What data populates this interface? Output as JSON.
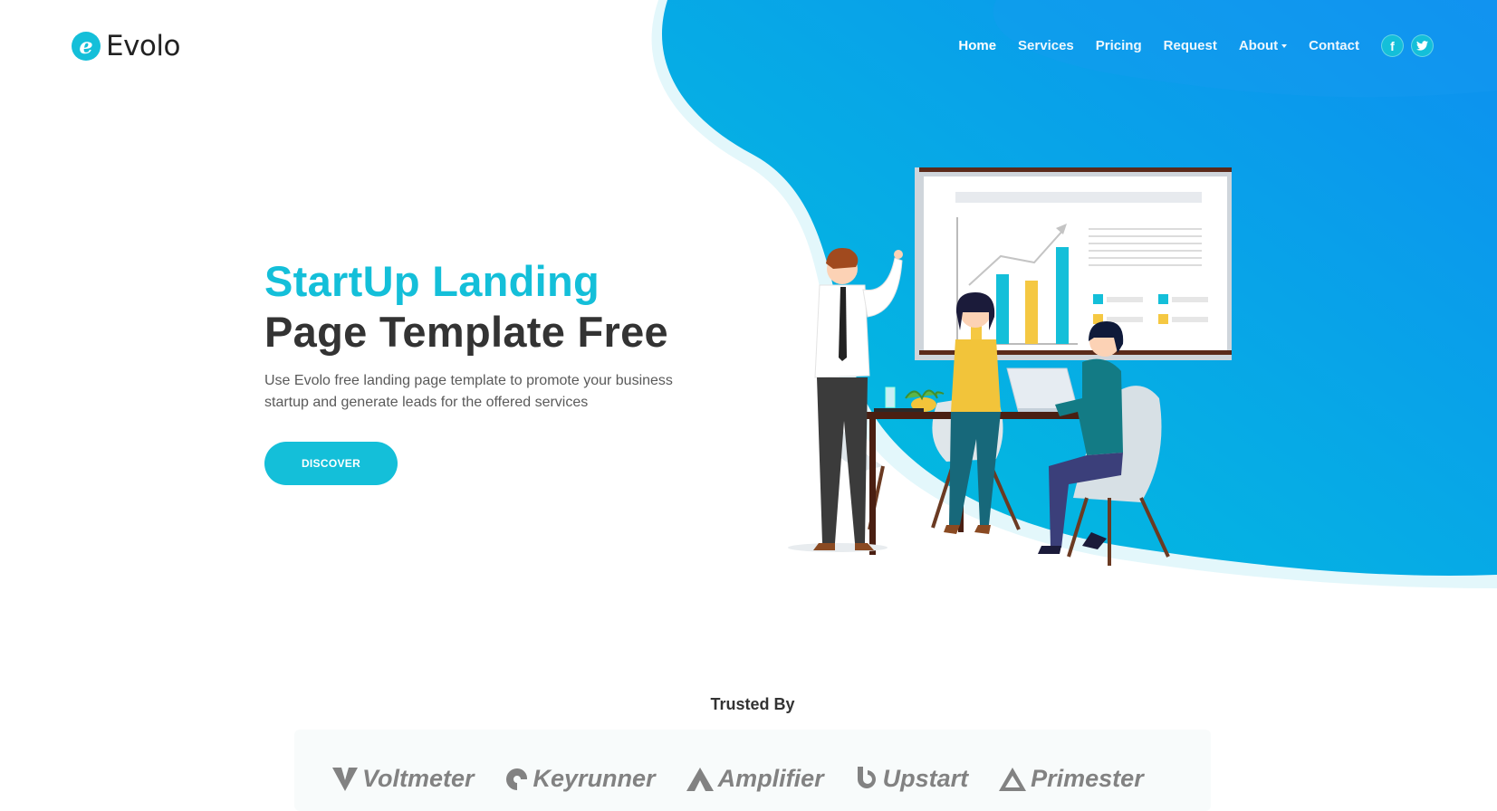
{
  "colors": {
    "accent": "#14bfd9",
    "heading": "#333333",
    "text": "#5a5a5a",
    "brand_logo": "#828282"
  },
  "brand": {
    "letter": "e",
    "name": "Evolo"
  },
  "nav": {
    "items": [
      "Home",
      "Services",
      "Pricing",
      "Request",
      "About",
      "Contact"
    ],
    "active": "Home"
  },
  "social": [
    {
      "icon": "facebook-icon",
      "glyph": "f"
    },
    {
      "icon": "twitter-icon"
    }
  ],
  "hero": {
    "title_line1": "StartUp Landing",
    "title_line2": "Page Template Free",
    "description": "Use Evolo free landing page template to promote your business startup and generate leads for the offered services",
    "cta": "DISCOVER"
  },
  "trusted": {
    "title": "Trusted By",
    "logos": [
      "Voltmeter",
      "Keyrunner",
      "Amplifier",
      "Upstart",
      "Primester"
    ]
  }
}
